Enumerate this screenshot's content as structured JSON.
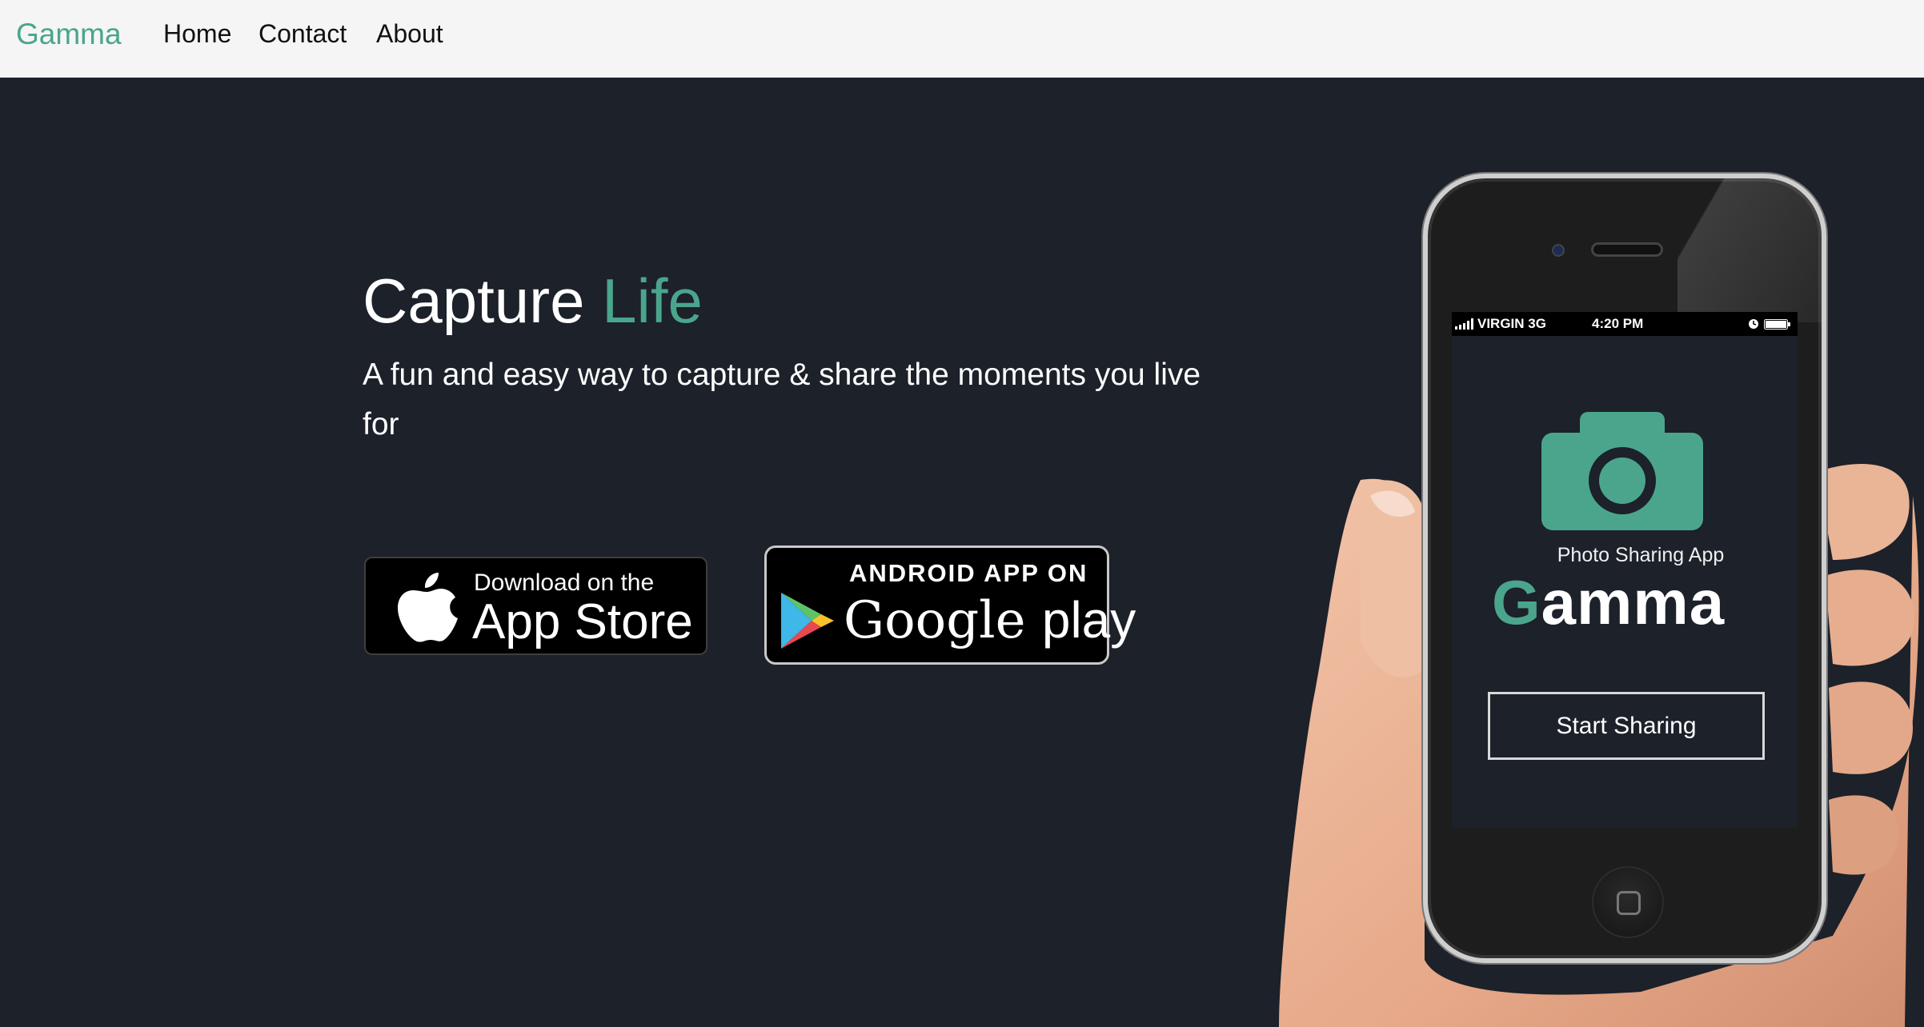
{
  "navbar": {
    "brand": "Gamma",
    "links": [
      "Home",
      "Contact",
      "About"
    ]
  },
  "hero": {
    "title_main": "Capture",
    "title_accent": "Life",
    "subtitle": "A fun and easy way to capture & share the moments you live for"
  },
  "badges": {
    "app_store": {
      "small": "Download on the",
      "big": "App Store"
    },
    "google_play": {
      "small": "ANDROID APP ON",
      "big_main": "Google",
      "big_thin": "play"
    }
  },
  "phone": {
    "status": {
      "carrier": "VIRGIN  3G",
      "time": "4:20 PM"
    },
    "tagline": "Photo Sharing App",
    "app_name_first": "G",
    "app_name_rest": "amma",
    "button": "Start Sharing"
  },
  "colors": {
    "accent": "#4aa58c",
    "background": "#1c212a",
    "navbar": "#f5f5f5"
  }
}
